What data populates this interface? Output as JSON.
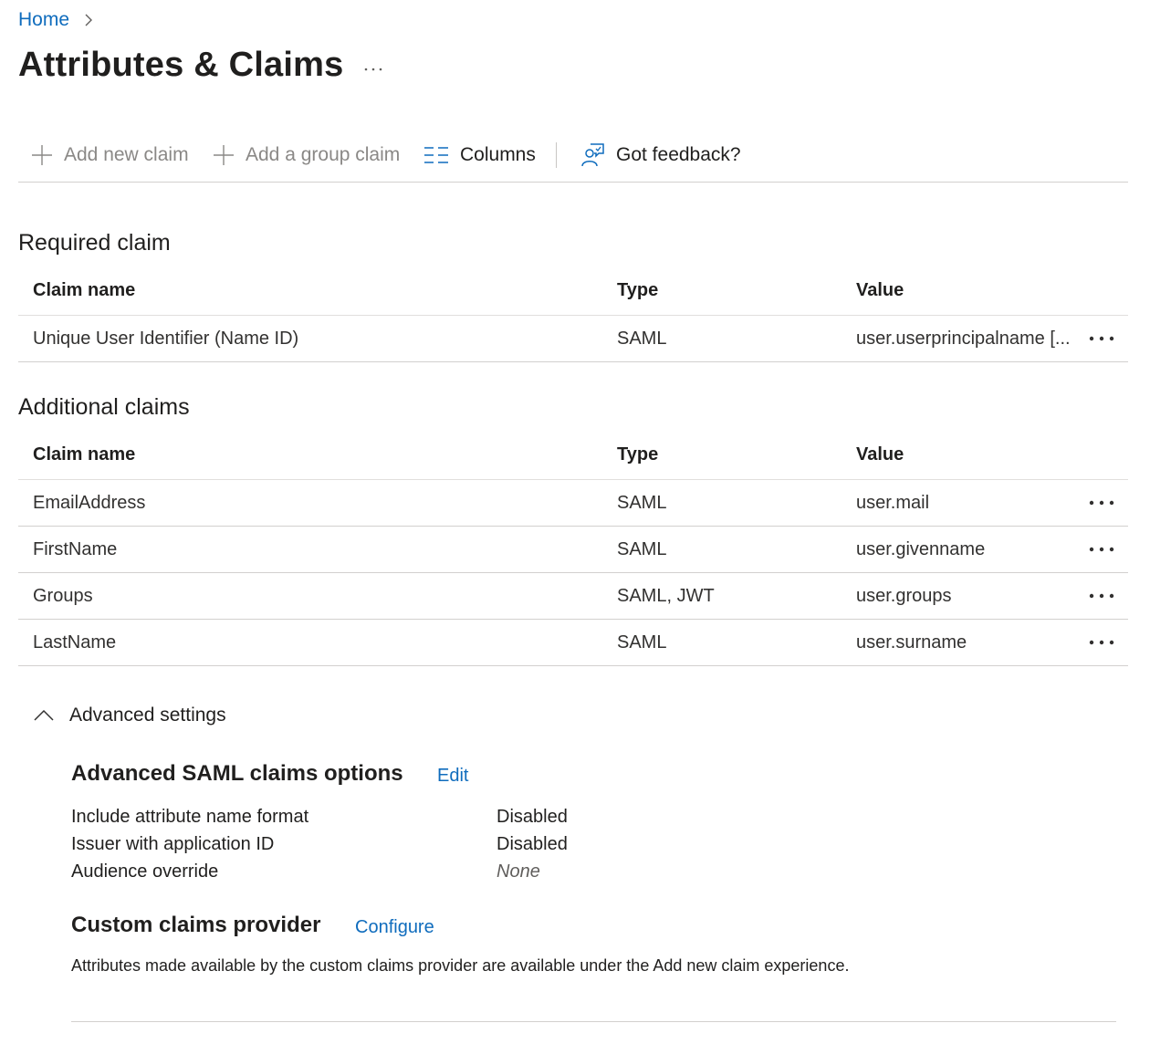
{
  "breadcrumb": {
    "home": "Home"
  },
  "page": {
    "title": "Attributes & Claims"
  },
  "toolbar": {
    "add_new_claim": "Add new claim",
    "add_group_claim": "Add a group claim",
    "columns": "Columns",
    "feedback": "Got feedback?"
  },
  "required": {
    "title": "Required claim",
    "headers": {
      "name": "Claim name",
      "type": "Type",
      "value": "Value"
    },
    "rows": [
      {
        "name": "Unique User Identifier (Name ID)",
        "type": "SAML",
        "value": "user.userprincipalname [..."
      }
    ]
  },
  "additional": {
    "title": "Additional claims",
    "headers": {
      "name": "Claim name",
      "type": "Type",
      "value": "Value"
    },
    "rows": [
      {
        "name": "EmailAddress",
        "type": "SAML",
        "value": "user.mail"
      },
      {
        "name": "FirstName",
        "type": "SAML",
        "value": "user.givenname"
      },
      {
        "name": "Groups",
        "type": "SAML, JWT",
        "value": "user.groups"
      },
      {
        "name": "LastName",
        "type": "SAML",
        "value": "user.surname"
      }
    ]
  },
  "advanced": {
    "toggle_label": "Advanced settings",
    "saml_options_title": "Advanced SAML claims options",
    "edit_label": "Edit",
    "settings": [
      {
        "label": "Include attribute name format",
        "value": "Disabled"
      },
      {
        "label": "Issuer with application ID",
        "value": "Disabled"
      },
      {
        "label": "Audience override",
        "value": "None"
      }
    ],
    "custom_provider_title": "Custom claims provider",
    "configure_label": "Configure",
    "custom_provider_desc": "Attributes made available by the custom claims provider are available under the Add new claim experience."
  },
  "colors": {
    "link": "#0f6cbd",
    "text": "#201f1e",
    "disabled": "#8a8886",
    "divider": "#d2d0ce"
  },
  "icons": [
    "chevron-right-icon",
    "more-horizontal-icon",
    "add-icon",
    "columns-icon",
    "feedback-icon",
    "chevron-up-icon"
  ]
}
